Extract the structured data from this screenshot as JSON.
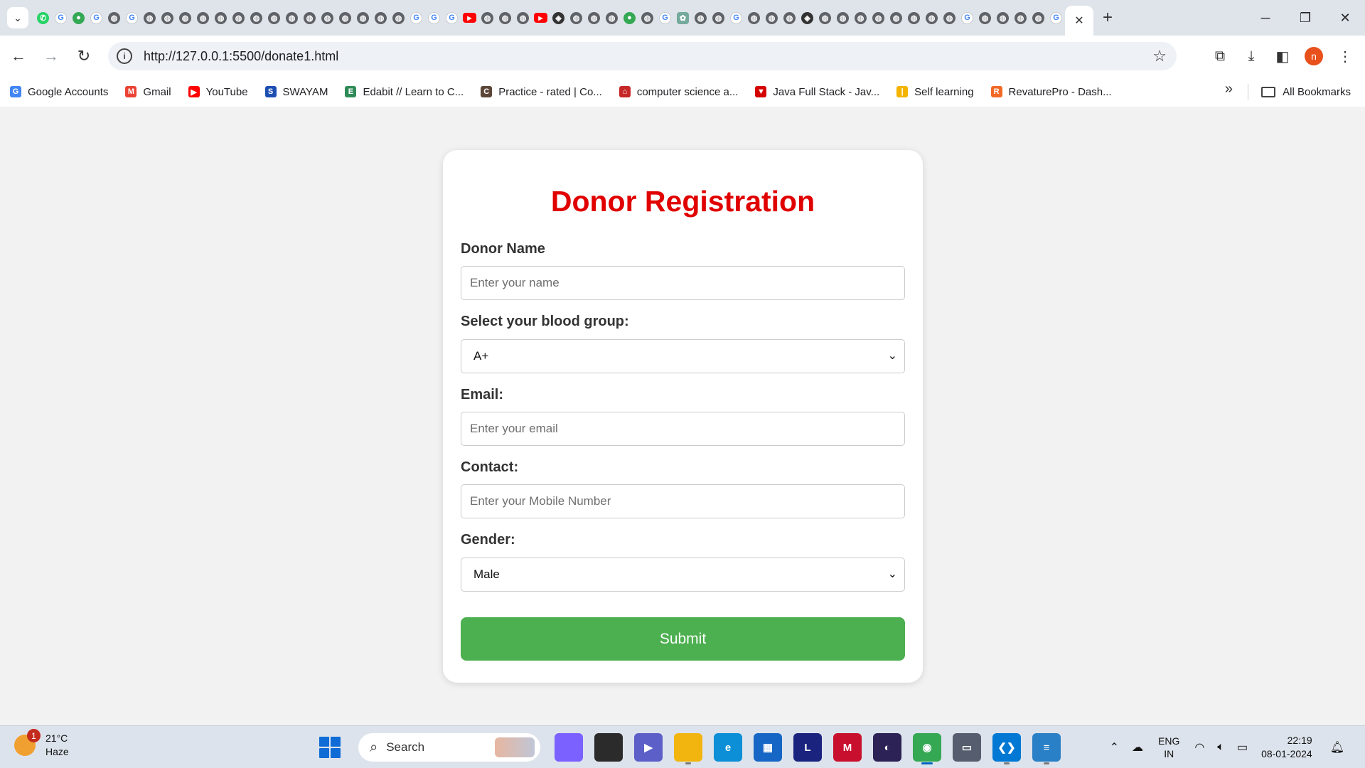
{
  "browser": {
    "active_tab_close": "✕",
    "new_tab": "+",
    "window": {
      "minimize": "─",
      "restore": "❐",
      "close": "✕"
    },
    "url": "http://127.0.0.1:5500/donate1.html",
    "profile_initial": "n",
    "bookmarks": [
      {
        "label": "Google Accounts",
        "icon": "google-icon",
        "color": "#4285f4",
        "glyph": "G"
      },
      {
        "label": "Gmail",
        "icon": "gmail-icon",
        "color": "#ea4335",
        "glyph": "M"
      },
      {
        "label": "YouTube",
        "icon": "youtube-icon",
        "color": "#ff0000",
        "glyph": "▶"
      },
      {
        "label": "SWAYAM",
        "icon": "swayam-icon",
        "color": "#1d4fb2",
        "glyph": "S"
      },
      {
        "label": "Edabit // Learn to C...",
        "icon": "edabit-icon",
        "color": "#2e8b57",
        "glyph": "E"
      },
      {
        "label": "Practice - rated | Co...",
        "icon": "codechef-icon",
        "color": "#5b4638",
        "glyph": "C"
      },
      {
        "label": "computer science a...",
        "icon": "house-icon",
        "color": "#c62828",
        "glyph": "⌂"
      },
      {
        "label": "Java Full Stack - Jav...",
        "icon": "triangle-icon",
        "color": "#d50000",
        "glyph": "▼"
      },
      {
        "label": "Self learning",
        "icon": "bars-icon",
        "color": "#f4b400",
        "glyph": "|"
      },
      {
        "label": "RevaturePro - Dash...",
        "icon": "revature-icon",
        "color": "#f26925",
        "glyph": "R"
      }
    ],
    "all_bookmarks": "All Bookmarks"
  },
  "page": {
    "title": "Donor Registration",
    "name_label": "Donor Name",
    "name_placeholder": "Enter your name",
    "blood_label": "Select your blood group:",
    "blood_value": "A+",
    "email_label": "Email:",
    "email_placeholder": "Enter your email",
    "contact_label": "Contact:",
    "contact_placeholder": "Enter your Mobile Number",
    "gender_label": "Gender:",
    "gender_value": "Male",
    "submit_label": "Submit"
  },
  "taskbar": {
    "weather_temp": "21°C",
    "weather_desc": "Haze",
    "weather_badge": "1",
    "search_label": "Search",
    "lang_top": "ENG",
    "lang_bottom": "IN",
    "time": "22:19",
    "date": "08-01-2024",
    "apps": [
      {
        "name": "copilot-icon",
        "color": "#7b61ff",
        "glyph": ""
      },
      {
        "name": "task-view-icon",
        "color": "#2b2b2b",
        "glyph": ""
      },
      {
        "name": "teams-icon",
        "color": "#5b5fc7",
        "glyph": "▶"
      },
      {
        "name": "file-explorer-icon",
        "color": "#f2b50f",
        "glyph": ""
      },
      {
        "name": "edge-icon",
        "color": "#0c8fd6",
        "glyph": "e"
      },
      {
        "name": "store-icon",
        "color": "#1666c5",
        "glyph": "▦"
      },
      {
        "name": "l-app-icon",
        "color": "#1a237e",
        "glyph": "L"
      },
      {
        "name": "mcafee-icon",
        "color": "#c8102e",
        "glyph": "M"
      },
      {
        "name": "eclipse-icon",
        "color": "#2c2255",
        "glyph": "◐"
      },
      {
        "name": "chrome-icon",
        "color": "#34a853",
        "glyph": "◉"
      },
      {
        "name": "sql-icon",
        "color": "#555d6e",
        "glyph": "▭"
      },
      {
        "name": "vscode-icon",
        "color": "#0078d4",
        "glyph": "❮❯"
      },
      {
        "name": "notepad-icon",
        "color": "#2a80c6",
        "glyph": "≡"
      }
    ]
  },
  "colors": {
    "title_red": "#e00000",
    "submit_green": "#4caf50",
    "page_bg": "#f2f2f2"
  }
}
